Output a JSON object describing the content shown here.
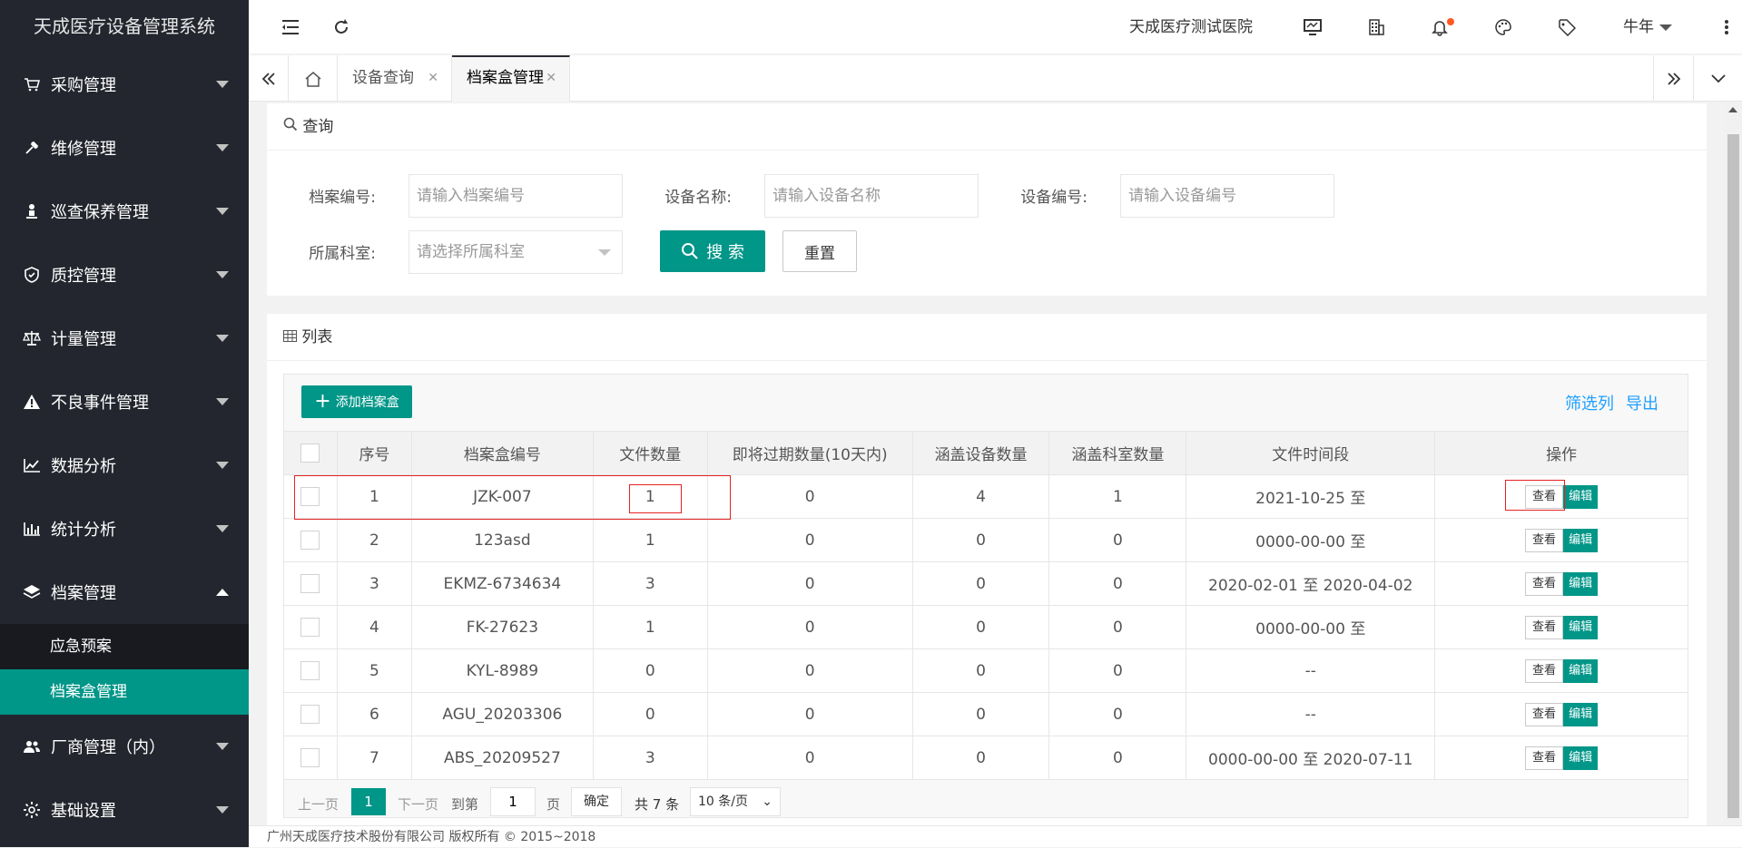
{
  "app": {
    "title": "天成医疗设备管理系统",
    "hospital": "天成医疗测试医院",
    "user": "牛年"
  },
  "sidebar": {
    "items": [
      {
        "label": "采购管理",
        "icon": "cart-icon"
      },
      {
        "label": "维修管理",
        "icon": "wrench-icon"
      },
      {
        "label": "巡查保养管理",
        "icon": "person-icon"
      },
      {
        "label": "质控管理",
        "icon": "shield-icon"
      },
      {
        "label": "计量管理",
        "icon": "balance-icon"
      },
      {
        "label": "不良事件管理",
        "icon": "warning-icon"
      },
      {
        "label": "数据分析",
        "icon": "trend-icon"
      },
      {
        "label": "统计分析",
        "icon": "bar-chart-icon"
      },
      {
        "label": "档案管理",
        "icon": "layers-icon"
      }
    ],
    "sub_items": [
      {
        "label": "应急预案"
      },
      {
        "label": "档案盒管理"
      }
    ],
    "items_after": [
      {
        "label": "厂商管理（内）",
        "icon": "users-icon"
      },
      {
        "label": "基础设置",
        "icon": "gear-icon"
      }
    ]
  },
  "tabs": [
    {
      "label": "设备查询"
    },
    {
      "label": "档案盒管理"
    }
  ],
  "search": {
    "title": "查询",
    "archive_no_label": "档案编号:",
    "archive_no_placeholder": "请输入档案编号",
    "device_name_label": "设备名称:",
    "device_name_placeholder": "请输入设备名称",
    "device_no_label": "设备编号:",
    "device_no_placeholder": "请输入设备编号",
    "dept_label": "所属科室:",
    "dept_placeholder": "请选择所属科室",
    "search_btn": "搜 索",
    "reset_btn": "重置"
  },
  "list": {
    "title": "列表",
    "add_btn": "添加档案盒",
    "filter_cols": "筛选列",
    "export": "导出",
    "headers": [
      "序号",
      "档案盒编号",
      "文件数量",
      "即将过期数量(10天内)",
      "涵盖设备数量",
      "涵盖科室数量",
      "文件时间段",
      "操作"
    ],
    "view_label": "查看",
    "edit_label": "编辑",
    "rows": [
      {
        "no": "1",
        "code": "JZK-007",
        "files": "1",
        "expiring": "0",
        "devices": "4",
        "depts": "1",
        "period": "2021-10-25 至"
      },
      {
        "no": "2",
        "code": "123asd",
        "files": "1",
        "expiring": "0",
        "devices": "0",
        "depts": "0",
        "period": "0000-00-00 至"
      },
      {
        "no": "3",
        "code": "EKMZ-6734634",
        "files": "3",
        "expiring": "0",
        "devices": "0",
        "depts": "0",
        "period": "2020-02-01 至 2020-04-02"
      },
      {
        "no": "4",
        "code": "FK-27623",
        "files": "1",
        "expiring": "0",
        "devices": "0",
        "depts": "0",
        "period": "0000-00-00 至"
      },
      {
        "no": "5",
        "code": "KYL-8989",
        "files": "0",
        "expiring": "0",
        "devices": "0",
        "depts": "0",
        "period": "--"
      },
      {
        "no": "6",
        "code": "AGU_20203306",
        "files": "0",
        "expiring": "0",
        "devices": "0",
        "depts": "0",
        "period": "--"
      },
      {
        "no": "7",
        "code": "ABS_20209527",
        "files": "3",
        "expiring": "0",
        "devices": "0",
        "depts": "0",
        "period": "0000-00-00 至 2020-07-11"
      }
    ]
  },
  "pager": {
    "prev": "上一页",
    "current": "1",
    "next": "下一页",
    "goto": "到第",
    "goto_value": "1",
    "page_unit": "页",
    "confirm": "确定",
    "total": "共 7 条",
    "size": "10 条/页"
  },
  "footer": "广州天成医疗技术股份有限公司 版权所有 © 2015~2018",
  "colors": {
    "accent": "#009688",
    "sidebar": "#23262e",
    "highlight": "#e52222",
    "link": "#1e9fff"
  }
}
